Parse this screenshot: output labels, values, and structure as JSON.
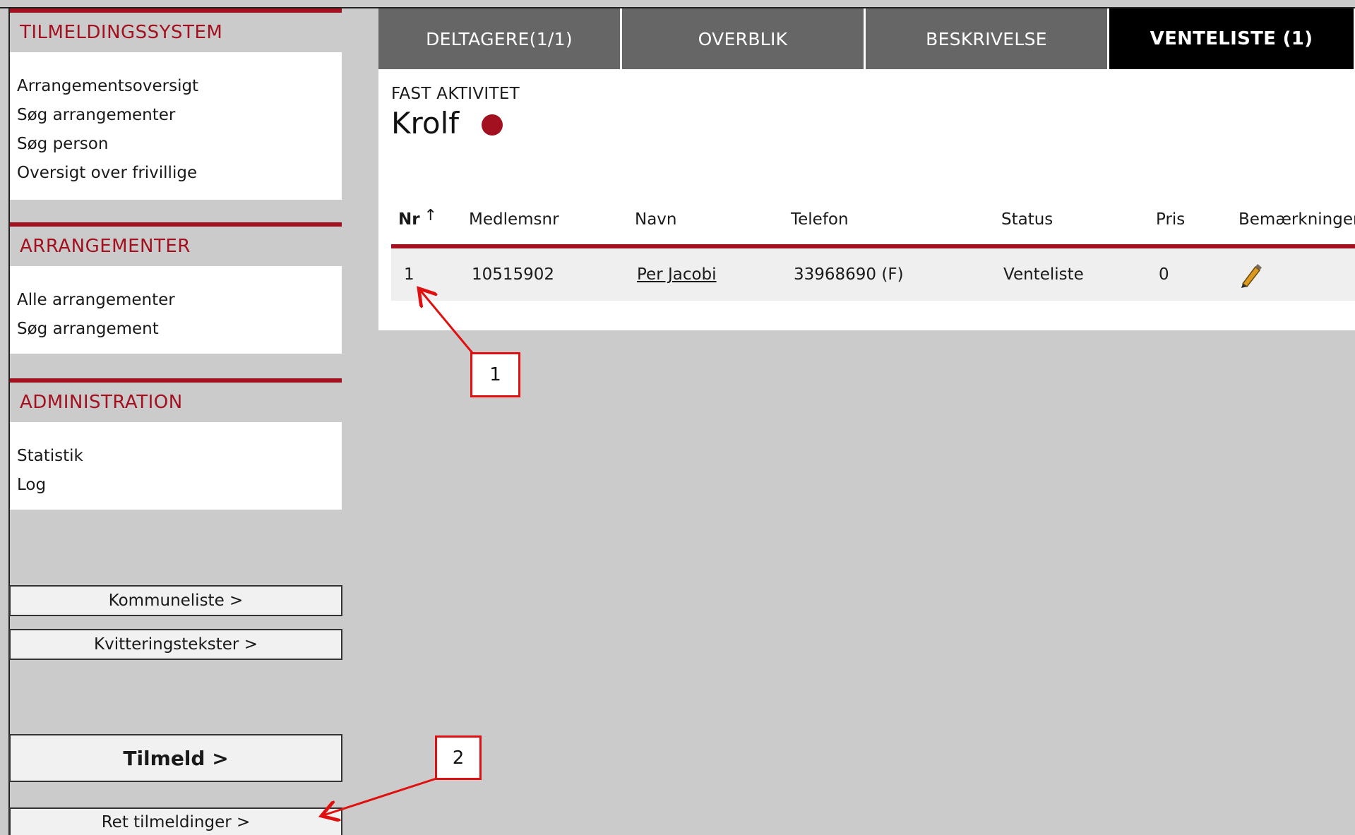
{
  "sidebar": {
    "system": {
      "header": "TILMELDINGSSYSTEM",
      "links": [
        "Arrangementsoversigt",
        "Søg arrangementer",
        "Søg person",
        "Oversigt over frivillige"
      ]
    },
    "events": {
      "header": "ARRANGEMENTER",
      "links": [
        "Alle arrangementer",
        "Søg arrangement"
      ]
    },
    "admin": {
      "header": "ADMINISTRATION",
      "links": [
        "Statistik",
        "Log"
      ]
    },
    "buttons": {
      "kommuneliste": "Kommuneliste >",
      "kvitteringstekster": "Kvitteringstekster >",
      "tilmeld": "Tilmeld >",
      "ret_tilmeldinger": "Ret tilmeldinger >"
    }
  },
  "tabs": [
    "DELTAGERE(1/1)",
    "OVERBLIK",
    "BESKRIVELSE",
    "VENTELISTE (1)"
  ],
  "active_tab_index": 3,
  "activity": {
    "type_label": "FAST AKTIVITET",
    "name": "Krolf",
    "status_color": "#a3101f"
  },
  "table": {
    "headers": {
      "nr": "Nr",
      "medlemsnr": "Medlemsnr",
      "navn": "Navn",
      "telefon": "Telefon",
      "status": "Status",
      "pris": "Pris",
      "bemaerkninger": "Bemærkninger"
    },
    "sort_icon": "arrow-up-icon",
    "rows": [
      {
        "nr": "1",
        "medlemsnr": "10515902",
        "navn": "Per Jacobi",
        "telefon": "33968690 (F)",
        "status": "Venteliste",
        "pris": "0",
        "bemaerkninger_icon": "pencil-icon"
      }
    ]
  },
  "callouts": [
    "1",
    "2"
  ],
  "colors": {
    "accent": "#a3101f",
    "tab_bg": "#666666",
    "tab_active_bg": "#000000",
    "annotation": "#e01010"
  }
}
